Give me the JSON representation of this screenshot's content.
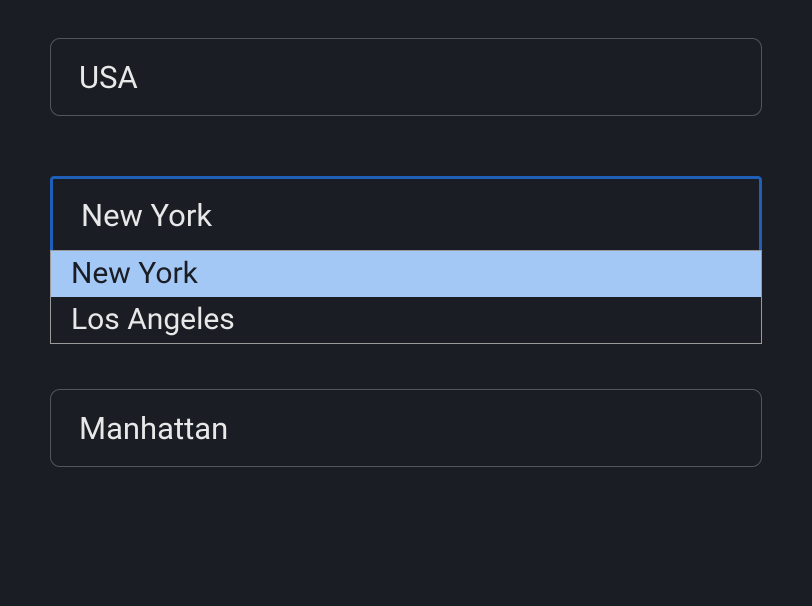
{
  "country": {
    "value": "USA"
  },
  "city": {
    "value": "New York",
    "options": [
      {
        "label": "New York",
        "highlighted": true
      },
      {
        "label": "Los Angeles",
        "highlighted": false
      }
    ]
  },
  "district": {
    "value": "Manhattan"
  }
}
